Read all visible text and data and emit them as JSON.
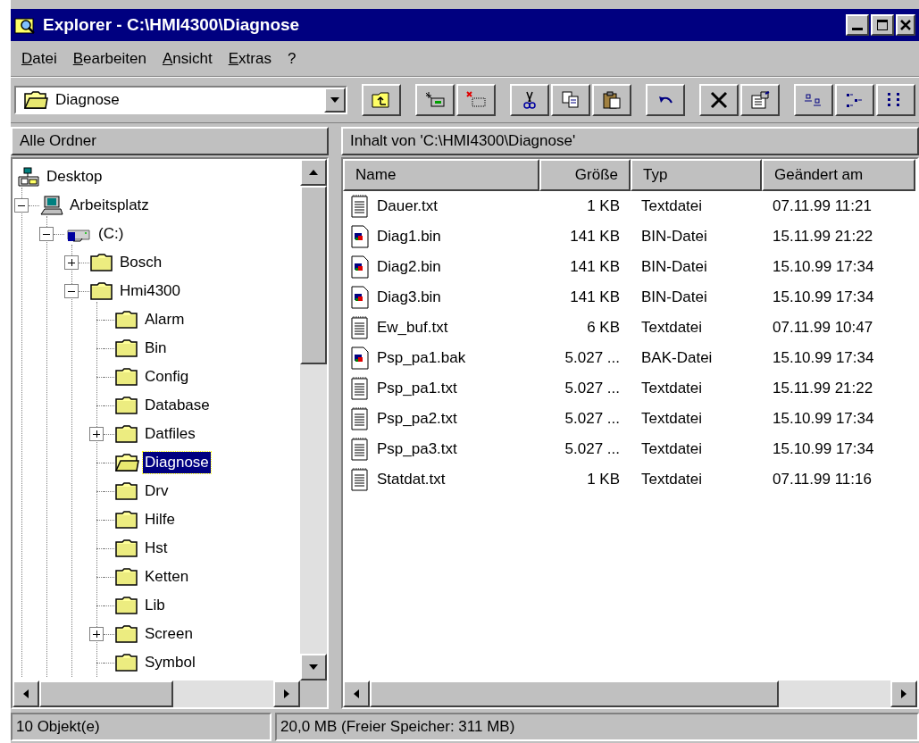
{
  "window": {
    "title": "Explorer - C:\\HMI4300\\Diagnose"
  },
  "menu": [
    {
      "label": "Datei"
    },
    {
      "label": "Bearbeiten"
    },
    {
      "label": "Ansicht"
    },
    {
      "label": "Extras"
    },
    {
      "label": "?"
    }
  ],
  "address": {
    "value": "Diagnose"
  },
  "toolbar": [
    {
      "kind": "up"
    },
    {
      "kind": "sep"
    },
    {
      "kind": "map"
    },
    {
      "kind": "unmap"
    },
    {
      "kind": "sep"
    },
    {
      "kind": "cut"
    },
    {
      "kind": "copy"
    },
    {
      "kind": "paste"
    },
    {
      "kind": "sep"
    },
    {
      "kind": "undo"
    },
    {
      "kind": "sep"
    },
    {
      "kind": "delete"
    },
    {
      "kind": "properties"
    },
    {
      "kind": "sep"
    },
    {
      "kind": "largeicons"
    },
    {
      "kind": "smallicons"
    },
    {
      "kind": "list"
    }
  ],
  "tree_header": "Alle Ordner",
  "content_header": "Inhalt von 'C:\\HMI4300\\Diagnose'",
  "tree": [
    {
      "label": "Desktop",
      "kind": "desktop",
      "selected": false,
      "children": [
        {
          "label": "Arbeitsplatz",
          "kind": "computer",
          "expanded": true,
          "selected": false,
          "children": [
            {
              "label": "(C:)",
              "kind": "drive",
              "expanded": true,
              "selected": false,
              "children": [
                {
                  "label": "Bosch",
                  "kind": "folder",
                  "expanded": false,
                  "selected": false
                },
                {
                  "label": "Hmi4300",
                  "kind": "folder",
                  "expanded": true,
                  "selected": false,
                  "children": [
                    {
                      "label": "Alarm",
                      "kind": "folder",
                      "selected": false
                    },
                    {
                      "label": "Bin",
                      "kind": "folder",
                      "selected": false
                    },
                    {
                      "label": "Config",
                      "kind": "folder",
                      "selected": false
                    },
                    {
                      "label": "Database",
                      "kind": "folder",
                      "selected": false
                    },
                    {
                      "label": "Datfiles",
                      "kind": "folder",
                      "expanded": false,
                      "selected": false
                    },
                    {
                      "label": "Diagnose",
                      "kind": "folder",
                      "selected": true
                    },
                    {
                      "label": "Drv",
                      "kind": "folder",
                      "selected": false
                    },
                    {
                      "label": "Hilfe",
                      "kind": "folder",
                      "selected": false
                    },
                    {
                      "label": "Hst",
                      "kind": "folder",
                      "selected": false
                    },
                    {
                      "label": "Ketten",
                      "kind": "folder",
                      "selected": false
                    },
                    {
                      "label": "Lib",
                      "kind": "folder",
                      "selected": false
                    },
                    {
                      "label": "Screen",
                      "kind": "folder",
                      "expanded": false,
                      "selected": false
                    },
                    {
                      "label": "Symbol",
                      "kind": "folder",
                      "selected": false
                    }
                  ]
                }
              ]
            }
          ]
        }
      ]
    }
  ],
  "table": {
    "columns": [
      "Name",
      "Größe",
      "Typ",
      "Geändert am"
    ],
    "rows": [
      {
        "kind": "text",
        "name": "Dauer.txt",
        "size": "1 KB",
        "type": "Textdatei",
        "modified": "07.11.99 11:21"
      },
      {
        "kind": "binary",
        "name": "Diag1.bin",
        "size": "141 KB",
        "type": "BIN-Datei",
        "modified": "15.11.99 21:22"
      },
      {
        "kind": "binary",
        "name": "Diag2.bin",
        "size": "141 KB",
        "type": "BIN-Datei",
        "modified": "15.10.99 17:34"
      },
      {
        "kind": "binary",
        "name": "Diag3.bin",
        "size": "141 KB",
        "type": "BIN-Datei",
        "modified": "15.10.99 17:34"
      },
      {
        "kind": "text",
        "name": "Ew_buf.txt",
        "size": "6 KB",
        "type": "Textdatei",
        "modified": "07.11.99 10:47"
      },
      {
        "kind": "binary",
        "name": "Psp_pa1.bak",
        "size": "5.027 ...",
        "type": "BAK-Datei",
        "modified": "15.10.99 17:34"
      },
      {
        "kind": "text",
        "name": "Psp_pa1.txt",
        "size": "5.027 ...",
        "type": "Textdatei",
        "modified": "15.11.99 21:22"
      },
      {
        "kind": "text",
        "name": "Psp_pa2.txt",
        "size": "5.027 ...",
        "type": "Textdatei",
        "modified": "15.10.99 17:34"
      },
      {
        "kind": "text",
        "name": "Psp_pa3.txt",
        "size": "5.027 ...",
        "type": "Textdatei",
        "modified": "15.10.99 17:34"
      },
      {
        "kind": "text",
        "name": "Statdat.txt",
        "size": "1 KB",
        "type": "Textdatei",
        "modified": "07.11.99 11:16"
      }
    ]
  },
  "status_bar": [
    "10 Objekt(e)",
    "20,0 MB (Freier Speicher: 311 MB)"
  ]
}
